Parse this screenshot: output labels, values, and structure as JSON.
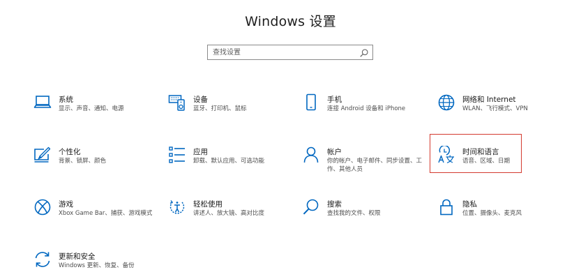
{
  "window": {
    "title": "Windows 设置"
  },
  "search": {
    "placeholder": "查找设置"
  },
  "accent_color": "#0067c0",
  "highlight_color": "#d43a2f",
  "tiles": [
    {
      "icon": "laptop-icon",
      "name": "系统",
      "desc": "显示、声音、通知、电源"
    },
    {
      "icon": "devices-icon",
      "name": "设备",
      "desc": "蓝牙、打印机、鼠标"
    },
    {
      "icon": "phone-icon",
      "name": "手机",
      "desc": "连接 Android 设备和 iPhone"
    },
    {
      "icon": "globe-icon",
      "name": "网络和 Internet",
      "desc": "WLAN、飞行模式、VPN"
    },
    {
      "icon": "personalization-icon",
      "name": "个性化",
      "desc": "背景、锁屏、颜色"
    },
    {
      "icon": "apps-icon",
      "name": "应用",
      "desc": "卸载、默认应用、可选功能"
    },
    {
      "icon": "person-icon",
      "name": "帐户",
      "desc": "你的帐户、电子邮件、同步设置、工作、其他人员"
    },
    {
      "icon": "time-language-icon",
      "name": "时间和语言",
      "desc": "语音、区域、日期"
    },
    {
      "icon": "xbox-icon",
      "name": "游戏",
      "desc": "Xbox Game Bar、捕获、游戏模式"
    },
    {
      "icon": "ease-of-access-icon",
      "name": "轻松使用",
      "desc": "讲述人、放大镜、高对比度"
    },
    {
      "icon": "search-icon",
      "name": "搜索",
      "desc": "查找我的文件、权限"
    },
    {
      "icon": "lock-icon",
      "name": "隐私",
      "desc": "位置、摄像头、麦克风"
    },
    {
      "icon": "update-icon",
      "name": "更新和安全",
      "desc": "Windows 更新、恢复、备份"
    }
  ]
}
